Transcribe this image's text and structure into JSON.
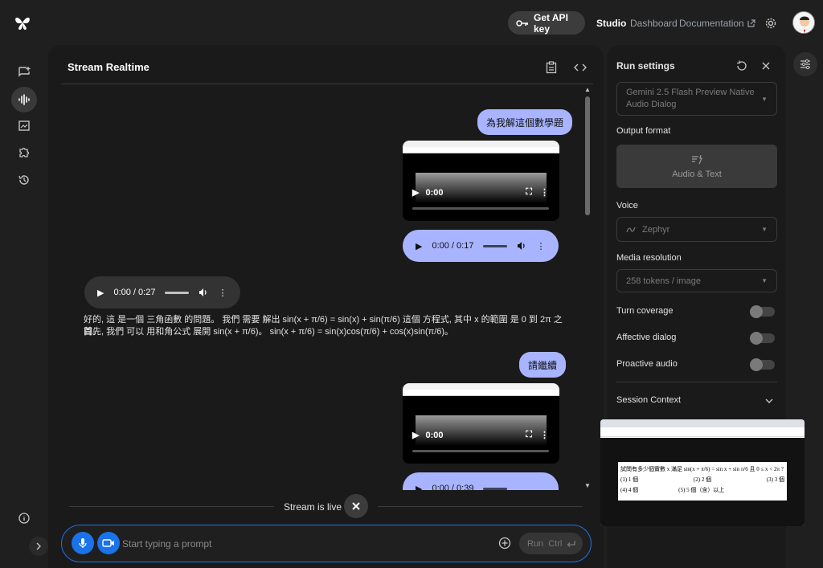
{
  "topbar": {
    "api_key_label": "Get API key",
    "nav": {
      "studio": "Studio",
      "dashboard": "Dashboard",
      "documentation": "Documentation"
    }
  },
  "panel": {
    "title": "Stream Realtime"
  },
  "chat": {
    "user_msg_1": "為我解這個數學題",
    "video_1_time": "0:00",
    "user_audio_1_time": "0:00 / 0:17",
    "model_audio_1_time": "0:00 / 0:27",
    "model_text_line_1": "好的, 這 是一個 三角函數 的問題。 我們 需要 解出 sin(x + π/6) = sin(x) + sin(π/6) 這個 方程式, 其中 x 的範圍 是 0 到 2π 之間。",
    "model_text_line_2": "首先, 我們 可以 用和角公式 展開 sin(x + π/6)。 sin(x + π/6) = sin(x)cos(π/6) + cos(x)sin(π/6)。",
    "user_msg_2": "請繼續",
    "video_2_time": "0:00",
    "user_audio_2_time": "0:00 / 0:39"
  },
  "live": {
    "label": "Stream is live"
  },
  "prompt": {
    "placeholder": "Start typing a prompt",
    "run_label": "Run",
    "shortcut": "Ctrl"
  },
  "settings": {
    "title": "Run settings",
    "model_line_1": "Gemini 2.5 Flash Preview Native",
    "model_line_2": "Audio Dialog",
    "output_format_label": "Output format",
    "output_format_value": "Audio & Text",
    "voice_label": "Voice",
    "voice_value": "Zephyr",
    "media_resolution_label": "Media resolution",
    "media_resolution_value": "258 tokens / image",
    "turn_coverage_label": "Turn coverage",
    "affective_dialog_label": "Affective dialog",
    "proactive_audio_label": "Proactive audio",
    "session_context_label": "Session Context",
    "turn_coverage_on": false,
    "affective_dialog_on": false,
    "proactive_audio_on": false
  },
  "preview": {
    "question": "試問有多少個實數 x 滿足 sin(x + π/6) = sin x + sin π/6 且 0 ≤ x < 2π ?",
    "opt1": "(1) 1 個",
    "opt2": "(2) 2 個",
    "opt3": "(3) 3 個",
    "opt4": "(4) 4 個",
    "opt5": "(5) 5 個（含）以上"
  },
  "colors": {
    "accent_blue": "#1a73e8",
    "user_bubble": "#a8b4ff",
    "background": "#1f1f1f"
  }
}
